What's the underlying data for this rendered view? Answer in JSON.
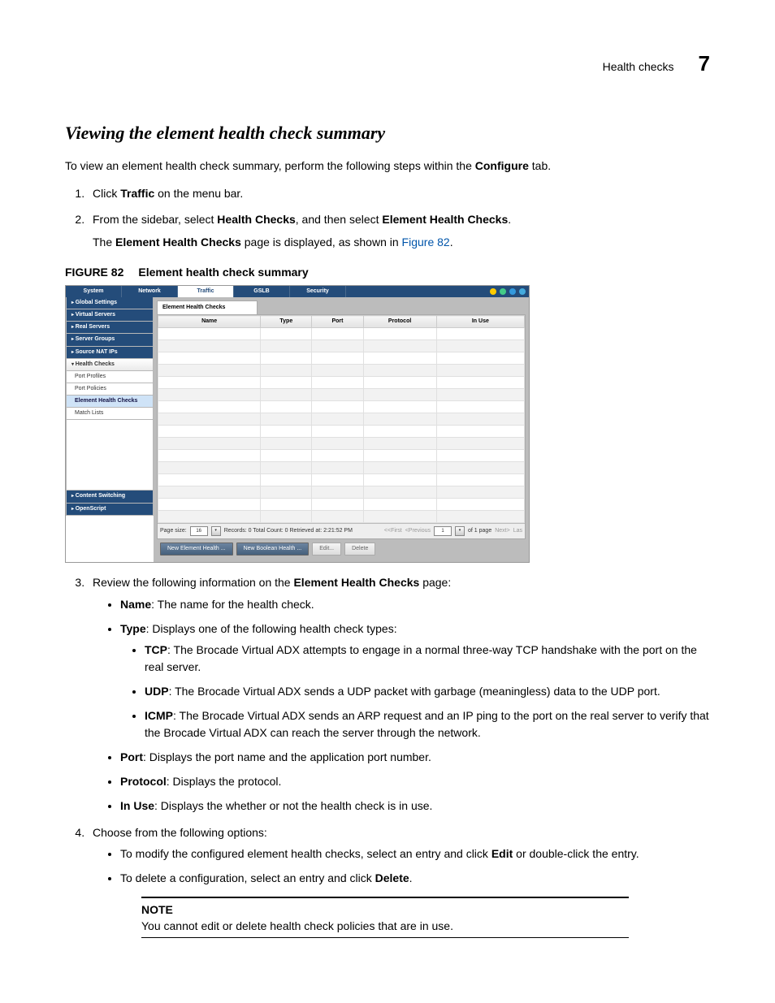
{
  "header": {
    "title": "Health checks",
    "chapter": "7"
  },
  "section_title": "Viewing the element health check summary",
  "intro": {
    "pre": "To view an element health check summary, perform the following steps within the ",
    "bold": "Configure",
    "post": " tab."
  },
  "steps": {
    "s1": {
      "pre": "Click ",
      "b": "Traffic",
      "post": " on the menu bar."
    },
    "s2": {
      "pre": "From the sidebar, select ",
      "b1": "Health Checks",
      "mid": ", and then select ",
      "b2": "Element Health Checks",
      "post": ".",
      "sub_pre": "The ",
      "sub_b": "Element Health Checks",
      "sub_mid": " page is displayed, as shown in ",
      "sub_link": "Figure 82",
      "sub_post": "."
    },
    "s3": {
      "pre": "Review the following information on the ",
      "b": "Element Health Checks",
      "post": " page:"
    },
    "s4": "Choose from the following options:"
  },
  "figcap": {
    "label": "FIGURE 82",
    "text": "Element health check summary"
  },
  "app": {
    "topbar": [
      "System",
      "Network",
      "Traffic",
      "GSLB",
      "Security"
    ],
    "topbar_selected": "Traffic",
    "sidebar_main": [
      "Global Settings",
      "Virtual Servers",
      "Real Servers",
      "Server Groups",
      "Source NAT IPs"
    ],
    "sidebar_open": "Health Checks",
    "sidebar_sub": [
      "Port Profiles",
      "Port Policies",
      "Element Health Checks",
      "Match Lists"
    ],
    "sidebar_selected": "Element Health Checks",
    "sidebar_tail": [
      "Content Switching",
      "OpenScript"
    ],
    "content_tab": "Element Health Checks",
    "columns": [
      "Name",
      "Type",
      "Port",
      "Protocol",
      "In Use"
    ],
    "pager": {
      "pagesize_label": "Page size:",
      "pagesize_value": "16",
      "records": "Records: 0  Total Count: 0  Retrieved at: 2:21:52 PM",
      "first": "<<First",
      "prev": "<Previous",
      "pagenum": "1",
      "of": "of 1 page",
      "next": "Next>",
      "last": "Las"
    },
    "buttons": {
      "new_elem": "New Element Health ...",
      "new_bool": "New Boolean Health ...",
      "edit": "Edit...",
      "delete": "Delete"
    }
  },
  "fields": {
    "name": {
      "b": "Name",
      "t": ": The name for the health check."
    },
    "type": {
      "b": "Type",
      "t": ": Displays one of the following health check types:"
    },
    "tcp": {
      "b": "TCP",
      "t": ": The Brocade Virtual ADX attempts to engage in a normal three-way TCP handshake with the port on the real server."
    },
    "udp": {
      "b": "UDP",
      "t": ": The Brocade Virtual ADX sends a UDP packet with garbage (meaningless) data to the UDP port."
    },
    "icmp": {
      "b": "ICMP",
      "t": ": The Brocade Virtual ADX sends an ARP request and an IP ping to the port on the real server to verify that the Brocade Virtual ADX can reach the server through the network."
    },
    "port": {
      "b": "Port",
      "t": ": Displays the port name and the application port number."
    },
    "proto": {
      "b": "Protocol",
      "t": ": Displays the protocol."
    },
    "inuse": {
      "b": "In Use",
      "t": ": Displays the whether or not the health check is in use."
    }
  },
  "options": {
    "edit": {
      "pre": "To modify the configured element health checks, select an entry and click ",
      "b": "Edit",
      "post": " or double-click the entry."
    },
    "delete": {
      "pre": "To delete a configuration, select an entry and click ",
      "b": "Delete",
      "post": "."
    }
  },
  "note": {
    "title": "NOTE",
    "text": "You cannot edit or delete health check policies that are in use."
  }
}
